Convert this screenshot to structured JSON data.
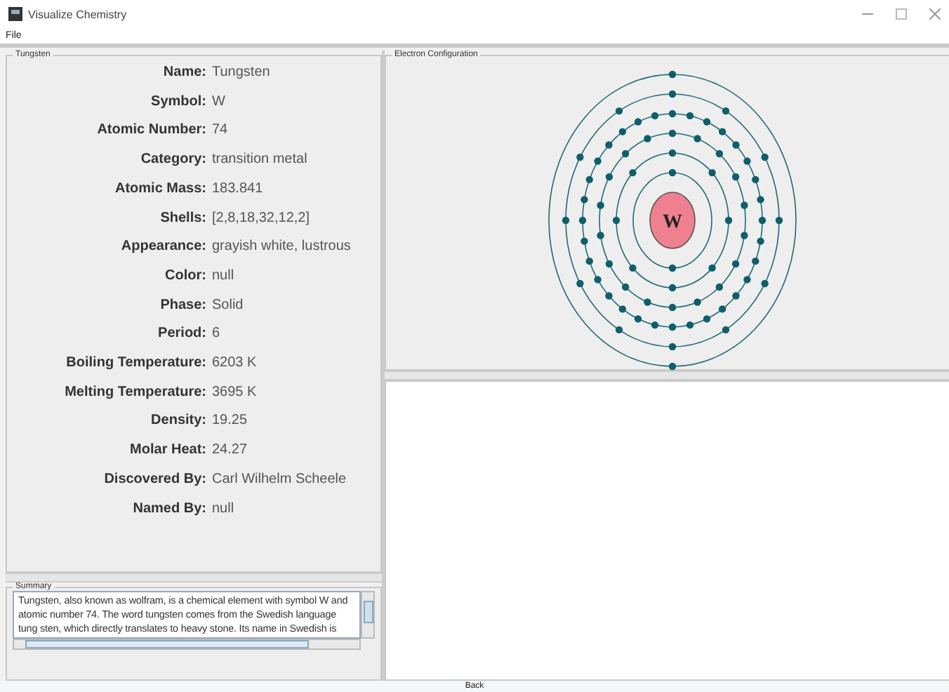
{
  "window": {
    "title": "Visualize Chemistry"
  },
  "menu": [
    "File"
  ],
  "element_panel": {
    "title": "Tungsten",
    "fields": [
      {
        "label": "Name:",
        "value": "Tungsten"
      },
      {
        "label": "Symbol:",
        "value": "W"
      },
      {
        "label": "Atomic Number:",
        "value": "74"
      },
      {
        "label": "Category:",
        "value": "transition metal"
      },
      {
        "label": "Atomic Mass:",
        "value": "183.841"
      },
      {
        "label": "Shells:",
        "value": "[2,8,18,32,12,2]"
      },
      {
        "label": "Appearance:",
        "value": "grayish white, lustrous"
      },
      {
        "label": "Color:",
        "value": "null"
      },
      {
        "label": "Phase:",
        "value": "Solid"
      },
      {
        "label": "Period:",
        "value": "6"
      },
      {
        "label": "Boiling Temperature:",
        "value": "6203 K"
      },
      {
        "label": "Melting Temperature:",
        "value": "3695 K"
      },
      {
        "label": "Density:",
        "value": "19.25"
      },
      {
        "label": "Molar Heat:",
        "value": "24.27"
      },
      {
        "label": "Discovered By:",
        "value": "Carl Wilhelm Scheele"
      },
      {
        "label": "Named By:",
        "value": "null"
      }
    ]
  },
  "summary": {
    "title": "Summary",
    "text": "Tungsten, also known as wolfram, is a chemical element with symbol W and atomic number 74. The word tungsten comes from the Swedish language tung sten, which directly translates to heavy stone. Its name in Swedish is"
  },
  "electron_panel": {
    "title": "Electron Configuration",
    "nucleus": "W"
  },
  "buttons": [
    "Back"
  ]
}
